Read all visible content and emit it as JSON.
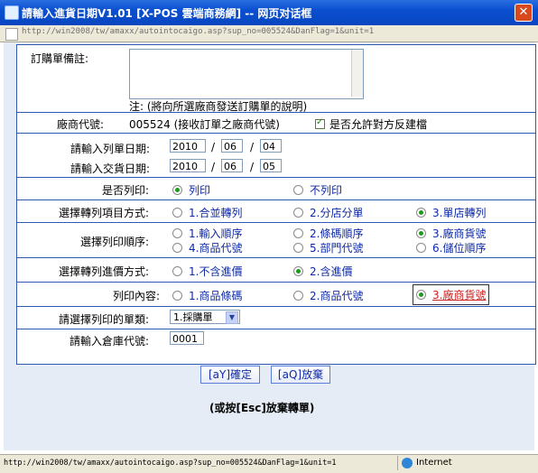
{
  "window": {
    "title": "請輸入進貨日期V1.01 [X-POS 雲端商務網] -- 网页对话框",
    "close_glyph": "✕",
    "address_url": "http://win2008/tw/amaxx/autointocaigo.asp?sup_no=005524&DanFlag=1&unit=1"
  },
  "remark": {
    "label": "訂購單備註:",
    "note": "注: (將向所選廠商發送訂購單的說明)"
  },
  "vendor": {
    "label": "廠商代號:",
    "value": "005524 (接收訂單之廠商代號)",
    "allow_feedback_label": "是否允許對方反建檔"
  },
  "dates": {
    "list_label": "請輸入列單日期:",
    "list_year": "2010",
    "list_month": "06",
    "list_day": "04",
    "delivery_label": "請輸入交貨日期:",
    "delivery_year": "2010",
    "delivery_month": "06",
    "delivery_day": "05",
    "separator": "/"
  },
  "print_option": {
    "label": "是否列印:",
    "yes": "列印",
    "no": "不列印"
  },
  "transfer_mode": {
    "label": "選擇轉列項目方式:",
    "opt1": "1.合並轉列",
    "opt2": "2.分店分單",
    "opt3": "3.單店轉列"
  },
  "print_order": {
    "label": "選擇列印順序:",
    "opt1": "1.輸入順序",
    "opt2": "2.條碼順序",
    "opt3": "3.廠商貨號",
    "opt4": "4.商品代號",
    "opt5": "5.部門代號",
    "opt6": "6.儲位順序"
  },
  "price_mode": {
    "label": "選擇轉列進價方式:",
    "opt1": "1.不含進價",
    "opt2": "2.含進價"
  },
  "print_content": {
    "label": "列印內容:",
    "opt1": "1.商品條碼",
    "opt2": "2.商品代號",
    "opt3": "3.廠商貨號"
  },
  "doc_type": {
    "label": "請選擇列印的單類:",
    "value": "1.採購單"
  },
  "warehouse": {
    "label": "請輸入倉庫代號:",
    "value": "0001"
  },
  "buttons": {
    "confirm": "[aY]確定",
    "abandon": "[aQ]放棄"
  },
  "hint": "(或按[Esc]放棄轉單)",
  "status": {
    "url": "http://win2008/tw/amaxx/autointocaigo.asp?sup_no=005524&DanFlag=1&unit=1",
    "zone": "Internet"
  },
  "colors": {
    "accent": "#0f2aa8",
    "border": "#2f59b5",
    "highlight": "#cc2222"
  }
}
